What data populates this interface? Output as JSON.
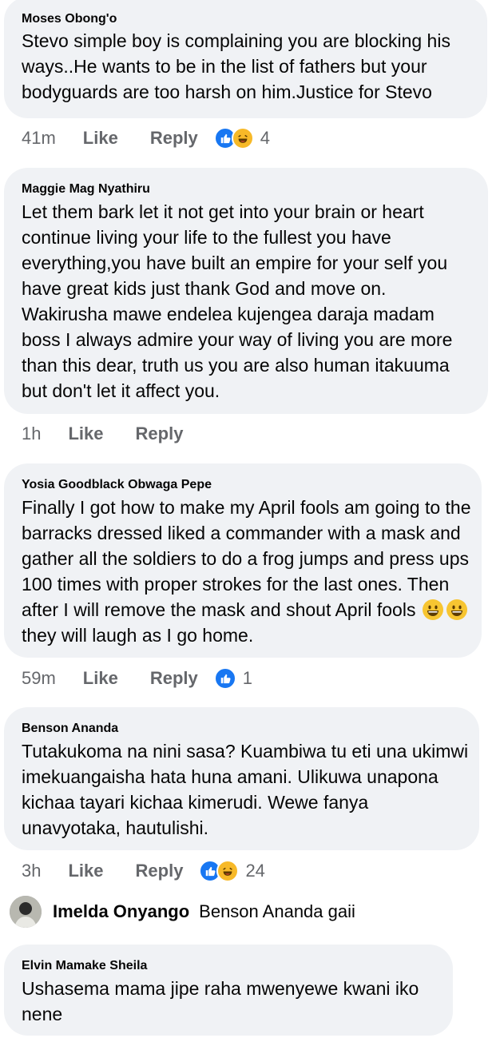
{
  "comments": [
    {
      "author": "Moses Obong'o",
      "text": "Stevo simple boy is complaining you are blocking his ways..He wants to be in the list of fathers but your bodyguards are too harsh on him.Justice for Stevo",
      "time": "41m",
      "like_label": "Like",
      "reply_label": "Reply",
      "reactions": [
        "like-icon",
        "haha-icon"
      ],
      "reaction_count": "4"
    },
    {
      "author": "Maggie Mag Nyathiru",
      "text": "Let them bark let it not get into your brain or heart continue living your life to the fullest you have everything,you have built an empire for your self you have great kids just thank God and move on. Wakirusha mawe endelea kujengea daraja madam boss I always admire your way of living you are more than this dear, truth us you are also human itakuuma but don't let it affect you.",
      "time": "1h",
      "like_label": "Like",
      "reply_label": "Reply"
    },
    {
      "author": "Yosia Goodblack Obwaga Pepe",
      "text_before_emoji": "Finally I got how to make my April fools am going to the barracks dressed liked a commander with a mask and gather all the soldiers to do a frog jumps and press ups 100 times with proper strokes for the last ones. Then after I will remove the mask and shout April fools",
      "text_after_emoji": "they will laugh as I go home.",
      "emojis": [
        "grinning-face-icon",
        "grinning-face-icon"
      ],
      "time": "59m",
      "like_label": "Like",
      "reply_label": "Reply",
      "reactions": [
        "like-icon"
      ],
      "reaction_count": "1"
    },
    {
      "author": "Benson Ananda",
      "text": "Tutakukoma na nini sasa? Kuambiwa tu eti una ukimwi imekuangaisha hata huna amani. Ulikuwa unapona kichaa tayari kichaa kimerudi. Wewe fanya unavyotaka, hautulishi.",
      "time": "3h",
      "like_label": "Like",
      "reply_label": "Reply",
      "reactions": [
        "like-icon",
        "haha-icon"
      ],
      "reaction_count": "24"
    }
  ],
  "reply_preview": {
    "author": "Imelda Onyango",
    "text": "Benson Ananda gaii"
  },
  "last_comment": {
    "author": "Elvin Mamake Sheila",
    "text": "Ushasema mama jipe raha mwenyewe kwani iko nene"
  },
  "colors": {
    "bubble": "#f0f2f5",
    "meta": "#65676b",
    "like": "#1877f2",
    "haha": "#f7b928"
  }
}
